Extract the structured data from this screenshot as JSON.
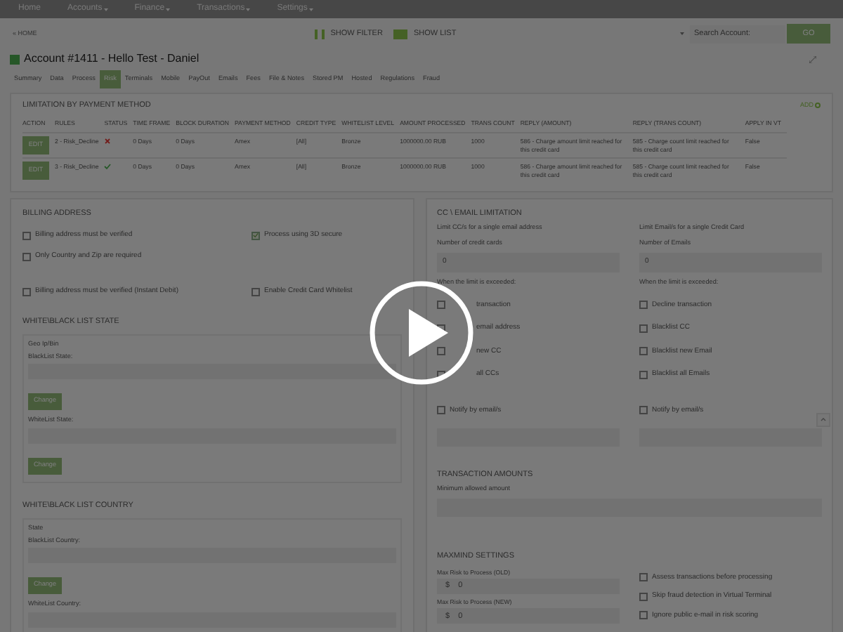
{
  "nav": [
    {
      "label": "Home",
      "dropdown": false
    },
    {
      "label": "Accounts",
      "dropdown": true
    },
    {
      "label": "Finance",
      "dropdown": true
    },
    {
      "label": "Transactions",
      "dropdown": true
    },
    {
      "label": "Settings",
      "dropdown": true
    }
  ],
  "toolbar": {
    "back_link": "« HOME",
    "show_filter": "SHOW FILTER",
    "show_list": "SHOW LIST",
    "search": {
      "placeholder": "Search Account:"
    },
    "go": "GO"
  },
  "account_title": "Account #1411 - Hello Test - Daniel",
  "tabs": [
    {
      "label": "Summary",
      "selected": false
    },
    {
      "label": "Data",
      "selected": false
    },
    {
      "label": "Process",
      "selected": false
    },
    {
      "label": "Risk",
      "selected": true
    },
    {
      "label": "Terminals",
      "selected": false
    },
    {
      "label": "Mobile",
      "selected": false
    },
    {
      "label": "PayOut",
      "selected": false
    },
    {
      "label": "Emails",
      "selected": false
    },
    {
      "label": "Fees",
      "selected": false
    },
    {
      "label": "File & Notes",
      "selected": false
    },
    {
      "label": "Stored PM",
      "selected": false
    },
    {
      "label": "Hosted",
      "selected": false
    },
    {
      "label": "Regulations",
      "selected": false
    },
    {
      "label": "Fraud",
      "selected": false
    }
  ],
  "limitation": {
    "title": "LIMITATION BY PAYMENT METHOD",
    "add": "ADD",
    "columns": [
      "ACTION",
      "RULES",
      "STATUS",
      "TIME FRAME",
      "BLOCK DURATION",
      "PAYMENT METHOD",
      "CREDIT TYPE",
      "WHITELIST LEVEL",
      "AMOUNT PROCESSED",
      "TRANS COUNT",
      "REPLY (AMOUNT)",
      "REPLY (TRANS COUNT)",
      "APPLY IN VT"
    ],
    "rows": [
      {
        "active": false,
        "cells": [
          "EDIT",
          "2 - Risk_Decline",
          "",
          "0 Days",
          "0 Days",
          "Amex",
          "[All]",
          "Bronze",
          "1000000.00 RUB",
          "1000",
          "586 - Charge amount limit reached for this credit card",
          "585 - Charge count limit reached for this credit card",
          "False"
        ]
      },
      {
        "active": true,
        "cells": [
          "EDIT",
          "3 - Risk_Decline",
          "",
          "0 Days",
          "0 Days",
          "Amex",
          "[All]",
          "Bronze",
          "1000000.00 RUB",
          "1000",
          "586 - Charge amount limit reached for this credit card",
          "585 - Charge count limit reached for this credit card",
          "False"
        ]
      }
    ]
  },
  "billing": {
    "title": "BILLING ADDRESS",
    "rows": [
      [
        {
          "label": "Billing address must be verified",
          "checked": false
        },
        {
          "label": "Process using 3D secure",
          "checked": true
        }
      ],
      [
        {
          "label": "Only Country and Zip are required",
          "checked": false
        }
      ],
      [
        {
          "label": "Billing address must be verified (Instant Debit)",
          "checked": false
        },
        {
          "label": "Enable Credit Card Whitelist",
          "checked": false
        }
      ]
    ]
  },
  "state_list": {
    "title": "WHITE\\BLACK LIST STATE",
    "heading": "Geo Ip/Bin",
    "groups": [
      {
        "label": "BlackList State:",
        "button": "Change"
      },
      {
        "label": "WhiteList State:",
        "button": "Change"
      }
    ]
  },
  "country_list": {
    "title": "WHITE\\BLACK LIST COUNTRY",
    "heading": "State",
    "groups": [
      {
        "label": "BlackList Country:",
        "button": "Change"
      },
      {
        "label": "WhiteList Country:"
      }
    ]
  },
  "cc_email": {
    "title": "CC \\ EMAIL LIMITATION",
    "columns": [
      {
        "heading": "Limit CC/s for a single email address",
        "field_label": "Number of credit cards",
        "value": "0",
        "when": "When the limit is exceeded:",
        "options": [
          {
            "label": "transaction",
            "checked": false
          },
          {
            "label": "email address",
            "checked": false
          },
          {
            "label": "new CC",
            "checked": false
          },
          {
            "label": "all CCs",
            "checked": false
          }
        ],
        "notify": {
          "label": "Notify by email/s",
          "checked": false
        }
      },
      {
        "heading": "Limit Email/s for a single Credit Card",
        "field_label": "Number of Emails",
        "value": "0",
        "when": "When the limit is exceeded:",
        "options": [
          {
            "label": "Decline transaction",
            "checked": false
          },
          {
            "label": "Blacklist CC",
            "checked": false
          },
          {
            "label": "Blacklist new Email",
            "checked": false
          },
          {
            "label": "Blacklist all Emails",
            "checked": false
          }
        ],
        "notify": {
          "label": "Notify by email/s",
          "checked": false
        }
      }
    ]
  },
  "transaction_amounts": {
    "title": "TRANSACTION AMOUNTS",
    "label": "Minimum allowed amount"
  },
  "maxmind": {
    "title": "MAXMIND SETTINGS",
    "fields": [
      {
        "label": "Max Risk to Process (OLD)",
        "prefix": "$",
        "value": "0"
      },
      {
        "label": "Max Risk to Process (NEW)",
        "prefix": "$",
        "value": "0"
      }
    ],
    "options": [
      {
        "label": "Assess transactions before processing",
        "checked": false
      },
      {
        "label": "Skip fraud detection in Virtual Terminal",
        "checked": false
      },
      {
        "label": "Ignore public e-mail in risk scoring",
        "checked": false
      }
    ]
  }
}
